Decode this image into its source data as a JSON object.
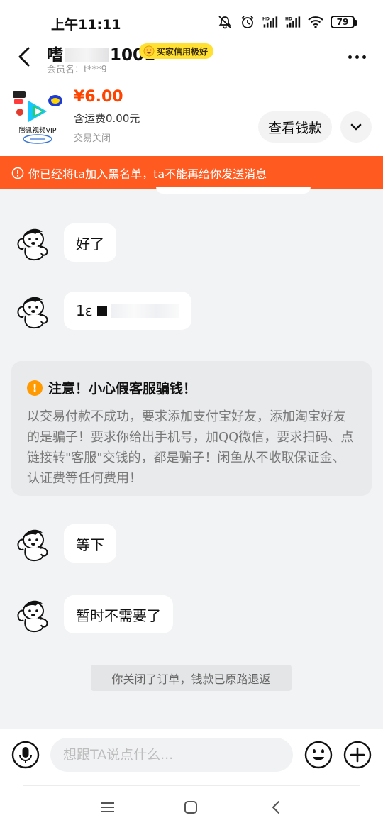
{
  "status_bar": {
    "time": "上午11:11",
    "icons": [
      "mute-bell-icon",
      "alarm-icon",
      "hd-signal-icon",
      "hd-signal-icon",
      "wifi-icon"
    ],
    "battery": "79"
  },
  "header": {
    "name_prefix": "嗜",
    "name_suffix": "1001",
    "badge": "买家信用极好",
    "member_id": "会员名：t***9"
  },
  "product": {
    "thumb_label": "腾讯视频VIP",
    "price": "¥6.00",
    "shipping": "含运费0.00元",
    "status": "交易关闭",
    "view_payment_label": "查看钱款"
  },
  "banner": {
    "text": "你已经将ta加入黑名单，ta不能再给你发送消息"
  },
  "messages": [
    {
      "text": "好了"
    },
    {
      "text": "1ε"
    },
    {
      "text": "等下"
    },
    {
      "text": "暂时不需要了"
    }
  ],
  "warning": {
    "title": "注意！小心假客服骗钱！",
    "body": "以交易付款不成功，要求添加支付宝好友，添加淘宝好友的是骗子！要求你给出手机号，加QQ微信，要求扫码、点链接转\"客服\"交钱的，都是骗子！闲鱼从不收取保证金、认证费等任何费用！"
  },
  "system_note": "你关闭了订单，钱款已原路退返",
  "input": {
    "placeholder": "想跟TA说点什么...",
    "value": ""
  },
  "colors": {
    "price": "#ff4400",
    "banner": "#ff5a1f",
    "badge": "#ffe033",
    "warning_icon": "#ff9a00"
  }
}
